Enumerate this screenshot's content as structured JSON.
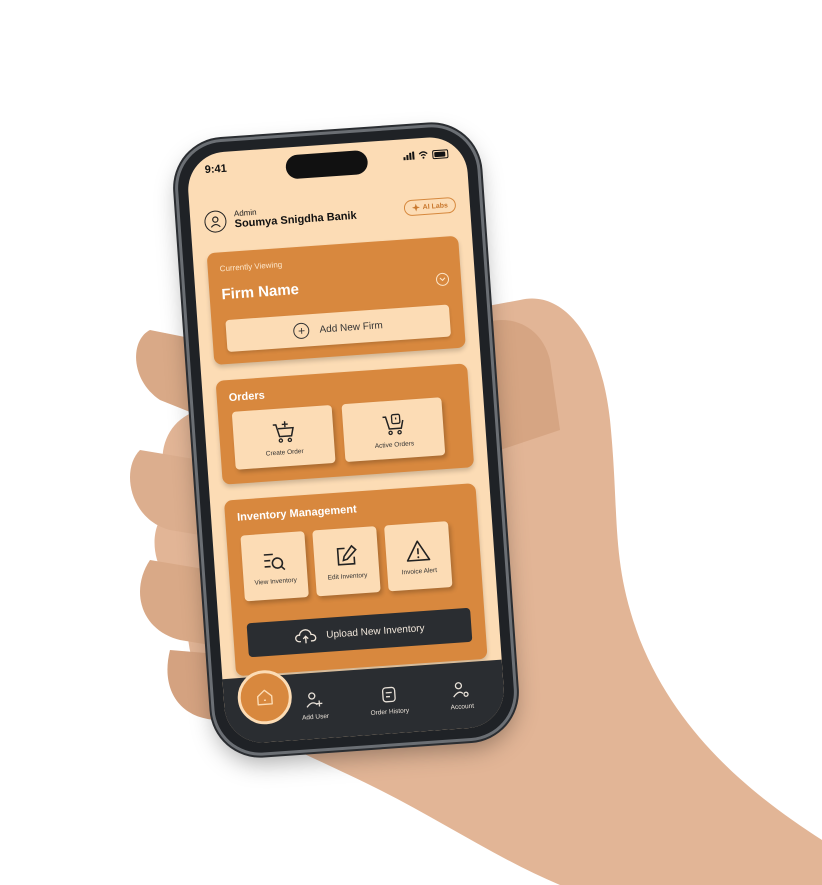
{
  "status": {
    "time": "9:41"
  },
  "header": {
    "role": "Admin",
    "user_name": "Soumya Snigdha Banik",
    "ai_button_label": "AI Labs"
  },
  "firm": {
    "caption": "Currently Viewing",
    "name": "Firm Name",
    "add_button_label": "Add New Firm"
  },
  "orders": {
    "title": "Orders",
    "tiles": [
      {
        "label": "Create Order",
        "icon": "cart-plus-icon"
      },
      {
        "label": "Active Orders",
        "icon": "cart-clock-icon"
      }
    ]
  },
  "inventory": {
    "title": "Inventory Management",
    "tiles": [
      {
        "label": "View Inventory",
        "icon": "list-search-icon"
      },
      {
        "label": "Edit Inventory",
        "icon": "edit-icon"
      },
      {
        "label": "Invoice Alert",
        "icon": "warning-icon"
      }
    ],
    "upload_label": "Upload New Inventory"
  },
  "nav": {
    "items": [
      {
        "label": "Add User",
        "icon": "add-user-icon"
      },
      {
        "label": "Order History",
        "icon": "order-history-icon"
      },
      {
        "label": "Account",
        "icon": "account-settings-icon"
      }
    ]
  },
  "colors": {
    "background": "#fcdcb5",
    "accent": "#d8883e",
    "dark": "#2a2d31"
  }
}
